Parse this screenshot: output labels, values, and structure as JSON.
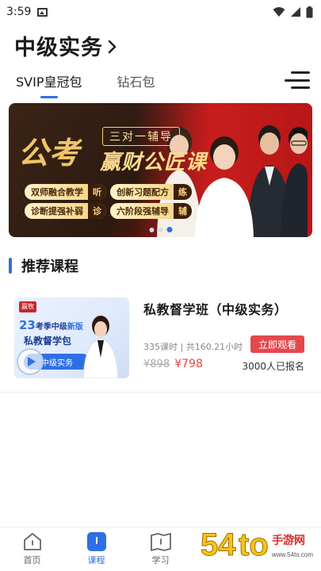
{
  "status_bar": {
    "time": "3:59"
  },
  "header": {
    "title": "中级实务"
  },
  "tabs": [
    {
      "label": "SVIP皇冠包",
      "active": true
    },
    {
      "label": "钻石包",
      "active": false
    }
  ],
  "banner": {
    "big_text": "公考",
    "subtitle": "三对一辅导",
    "headline": "赢财公匠课",
    "features": [
      {
        "label": "双师融合教学",
        "tag": "听"
      },
      {
        "label": "创新习题配方",
        "tag": "练"
      },
      {
        "label": "诊断提强补弱",
        "tag": "诊"
      },
      {
        "label": "六阶段强辅导",
        "tag": "辅"
      }
    ],
    "slide_count": 3,
    "active_slide": 3
  },
  "section": {
    "title": "推荐课程"
  },
  "course": {
    "thumb_logo": "嬴牧",
    "thumb_year": "23",
    "thumb_line1": "考季中级",
    "thumb_badge": "新版",
    "thumb_line2": "私教督学包",
    "thumb_pill": "中级实务",
    "title": "私教督学班（中级实务）",
    "meta": "335课时 | 共160.21小时",
    "old_price": "¥898",
    "new_price": "¥798",
    "watch_button": "立即观看",
    "enrolled": "3000人已报名"
  },
  "bottom_nav": [
    {
      "label": "首页",
      "icon": "home-icon",
      "active": false
    },
    {
      "label": "课程",
      "icon": "course-icon",
      "active": true
    },
    {
      "label": "学习",
      "icon": "book-icon",
      "active": false
    },
    {
      "label": "",
      "icon": "profile-icon",
      "active": false
    }
  ],
  "watermark": {
    "text": "54to手游网",
    "sub": "www.54to.com"
  },
  "colors": {
    "accent": "#2f6fe4",
    "price_red": "#e84545",
    "button_red": "#e4484d"
  }
}
